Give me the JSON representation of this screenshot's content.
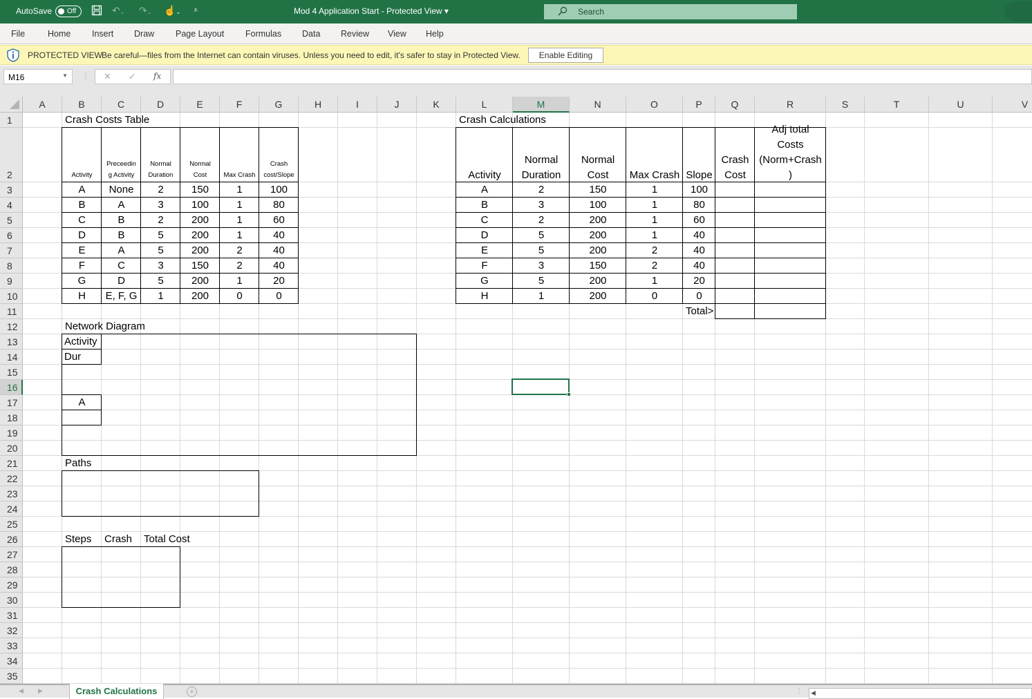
{
  "titlebar": {
    "autosave_label": "AutoSave",
    "autosave_state": "Off",
    "document_title": "Mod 4 Application Start  -  Protected View  ▾",
    "search_placeholder": "Search",
    "icons": [
      "save-icon",
      "undo-icon",
      "redo-icon",
      "touch-mode-icon",
      "customize-toolbar-icon"
    ]
  },
  "ribbon": {
    "tabs": [
      "File",
      "Home",
      "Insert",
      "Draw",
      "Page Layout",
      "Formulas",
      "Data",
      "Review",
      "View",
      "Help"
    ]
  },
  "protected_view": {
    "title": "PROTECTED VIEW",
    "message": "Be careful—files from the Internet can contain viruses. Unless you need to edit, it's safer to stay in Protected View.",
    "button": "Enable Editing"
  },
  "formula_bar": {
    "name_box": "M16",
    "cancel": "✕",
    "enter": "✓",
    "fx": "fx",
    "formula": ""
  },
  "columns": [
    "A",
    "B",
    "C",
    "D",
    "E",
    "F",
    "G",
    "H",
    "I",
    "J",
    "K",
    "L",
    "M",
    "N",
    "O",
    "P",
    "Q",
    "R",
    "S",
    "T",
    "U",
    "V"
  ],
  "selected_column": "M",
  "rows": [
    "1",
    "2",
    "3",
    "4",
    "5",
    "6",
    "7",
    "8",
    "9",
    "10",
    "11",
    "12",
    "13",
    "14",
    "15",
    "16",
    "17",
    "18",
    "19",
    "20",
    "21",
    "22",
    "23",
    "24",
    "25",
    "26",
    "27",
    "28",
    "29",
    "30",
    "31",
    "32",
    "33",
    "34",
    "35"
  ],
  "selected_row": "16",
  "crash_costs_table": {
    "title": "Crash Costs Table",
    "headers": [
      "Activity",
      "Preceedin g Activity",
      "Normal Duration",
      "Normal Cost",
      "Max Crash",
      "Crash cost/Slope"
    ],
    "header_lines": [
      [
        "Activity"
      ],
      [
        "Preceedin",
        "g Activity"
      ],
      [
        "Normal",
        "Duration"
      ],
      [
        "Normal",
        "Cost"
      ],
      [
        "Max Crash"
      ],
      [
        "Crash",
        "cost/Slope"
      ]
    ],
    "rows": [
      [
        "A",
        "None",
        "2",
        "150",
        "1",
        "100"
      ],
      [
        "B",
        "A",
        "3",
        "100",
        "1",
        "80"
      ],
      [
        "C",
        "B",
        "2",
        "200",
        "1",
        "60"
      ],
      [
        "D",
        "B",
        "5",
        "200",
        "1",
        "40"
      ],
      [
        "E",
        "A",
        "5",
        "200",
        "2",
        "40"
      ],
      [
        "F",
        "C",
        "3",
        "150",
        "2",
        "40"
      ],
      [
        "G",
        "D",
        "5",
        "200",
        "1",
        "20"
      ],
      [
        "H",
        "E, F, G",
        "1",
        "200",
        "0",
        "0"
      ]
    ]
  },
  "crash_calculations": {
    "title": "Crash Calculations",
    "header_lines": [
      [
        "Activity"
      ],
      [
        "Normal",
        "Duration"
      ],
      [
        "Normal",
        "Cost"
      ],
      [
        "Max Crash"
      ],
      [
        "Slope"
      ],
      [
        "Crash",
        "Cost"
      ],
      [
        "Adj total",
        "Costs",
        "(Norm+Crash",
        ")"
      ]
    ],
    "rows": [
      [
        "A",
        "2",
        "150",
        "1",
        "100",
        "",
        ""
      ],
      [
        "B",
        "3",
        "100",
        "1",
        "80",
        "",
        ""
      ],
      [
        "C",
        "2",
        "200",
        "1",
        "60",
        "",
        ""
      ],
      [
        "D",
        "5",
        "200",
        "1",
        "40",
        "",
        ""
      ],
      [
        "E",
        "5",
        "200",
        "2",
        "40",
        "",
        ""
      ],
      [
        "F",
        "3",
        "150",
        "2",
        "40",
        "",
        ""
      ],
      [
        "G",
        "5",
        "200",
        "1",
        "20",
        "",
        ""
      ],
      [
        "H",
        "1",
        "200",
        "0",
        "0",
        "",
        ""
      ]
    ],
    "total_label": "Total>",
    "total_crash_cost": "",
    "total_adj_cost": ""
  },
  "network_diagram": {
    "title": "Network Diagram",
    "legend_activity": "Activity",
    "legend_duration": "Dur",
    "node_activity": "A",
    "node_duration": ""
  },
  "paths": {
    "title": "Paths"
  },
  "steps_table": {
    "headers": [
      "Steps",
      "Crash",
      "Total Cost"
    ]
  },
  "sheets": {
    "active": "Crash Calculations",
    "add_label": "+"
  }
}
